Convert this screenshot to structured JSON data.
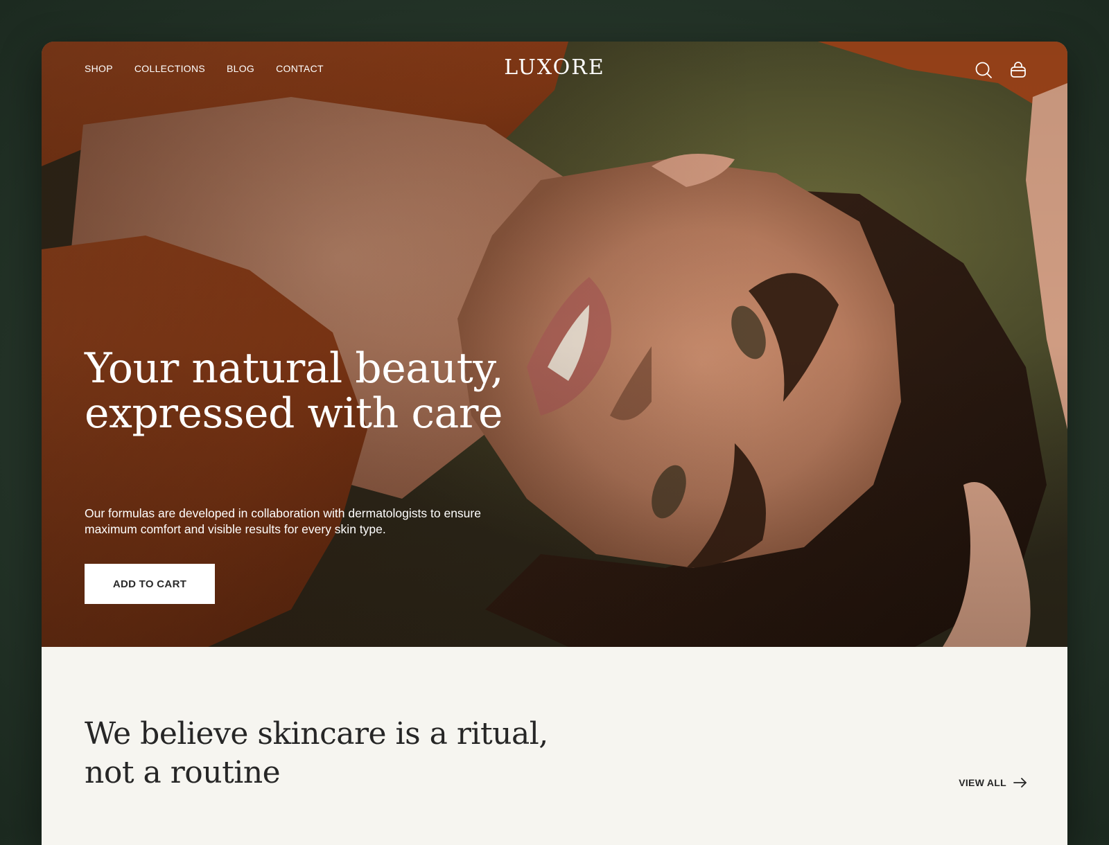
{
  "nav": {
    "links": [
      "SHOP",
      "COLLECTIONS",
      "BLOG",
      "CONTACT"
    ],
    "logo": "LUXORE",
    "icons": [
      "search-icon",
      "cart-icon"
    ]
  },
  "hero": {
    "title": "Your natural beauty, expressed with care",
    "subtitle": "Our formulas are developed in collaboration with dermatologists to ensure maximum comfort and visible results for every skin type.",
    "cta_label": "ADD TO CART"
  },
  "about": {
    "title": "We believe skincare is a ritual, not a routine",
    "view_all_label": "VIEW ALL"
  },
  "colors": {
    "page_background": "#26362a",
    "section_background": "#f6f5f0",
    "heading_text": "#262626",
    "button_background": "#ffffff"
  }
}
